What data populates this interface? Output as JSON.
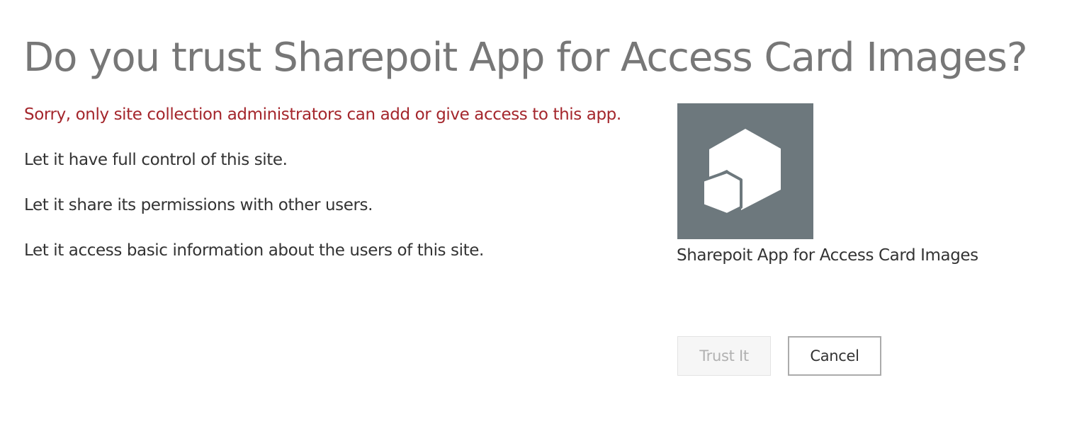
{
  "dialog": {
    "title": "Do you trust Sharepoit App for Access Card Images?",
    "error_message": "Sorry, only site collection administrators can add or give access to this app.",
    "permissions": [
      "Let it have full control of this site.",
      "Let it share its permissions with other users.",
      "Let it access basic information about the users of this site."
    ]
  },
  "app": {
    "name": "Sharepoit App for Access Card Images",
    "icon": "app-hexagons-icon",
    "tile_color": "#6d787d"
  },
  "buttons": {
    "trust_label": "Trust It",
    "trust_disabled": true,
    "cancel_label": "Cancel"
  },
  "colors": {
    "error": "#a4262c",
    "title": "#777777",
    "text": "#333333"
  }
}
